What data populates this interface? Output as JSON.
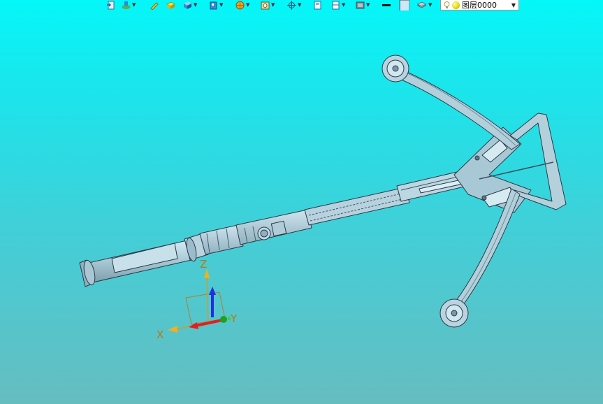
{
  "toolbar": {
    "layer_selector": {
      "value": "图层0000",
      "icons": [
        "lightbulb-icon",
        "sphere-icon"
      ]
    },
    "icon_buttons": [
      "import-icon",
      "layer-visibility-icon",
      "sketch-pencil-icon",
      "box-feature-icon",
      "solid-cube-icon",
      "view-cube-icon",
      "render-sphere-icon",
      "camera-icon",
      "snap-point-icon",
      "page-icon",
      "panel-icon",
      "display-mode-icon",
      "line-style-icon",
      "color-swatch-icon",
      "layers-stack-icon"
    ]
  },
  "triad": {
    "x_label": "X",
    "y_label": "Y",
    "z_label": "Z"
  },
  "model": {
    "name_icon": "crossbow-model"
  },
  "colors": {
    "background_top": "#04f7f9",
    "background_bottom": "#66bdc0",
    "model_fill": "#a9c8d6",
    "model_edge": "#2a3a44",
    "x_axis": "#e02020",
    "y_axis": "#20a020",
    "z_axis": "#2030e0",
    "label": "#b7780f"
  }
}
